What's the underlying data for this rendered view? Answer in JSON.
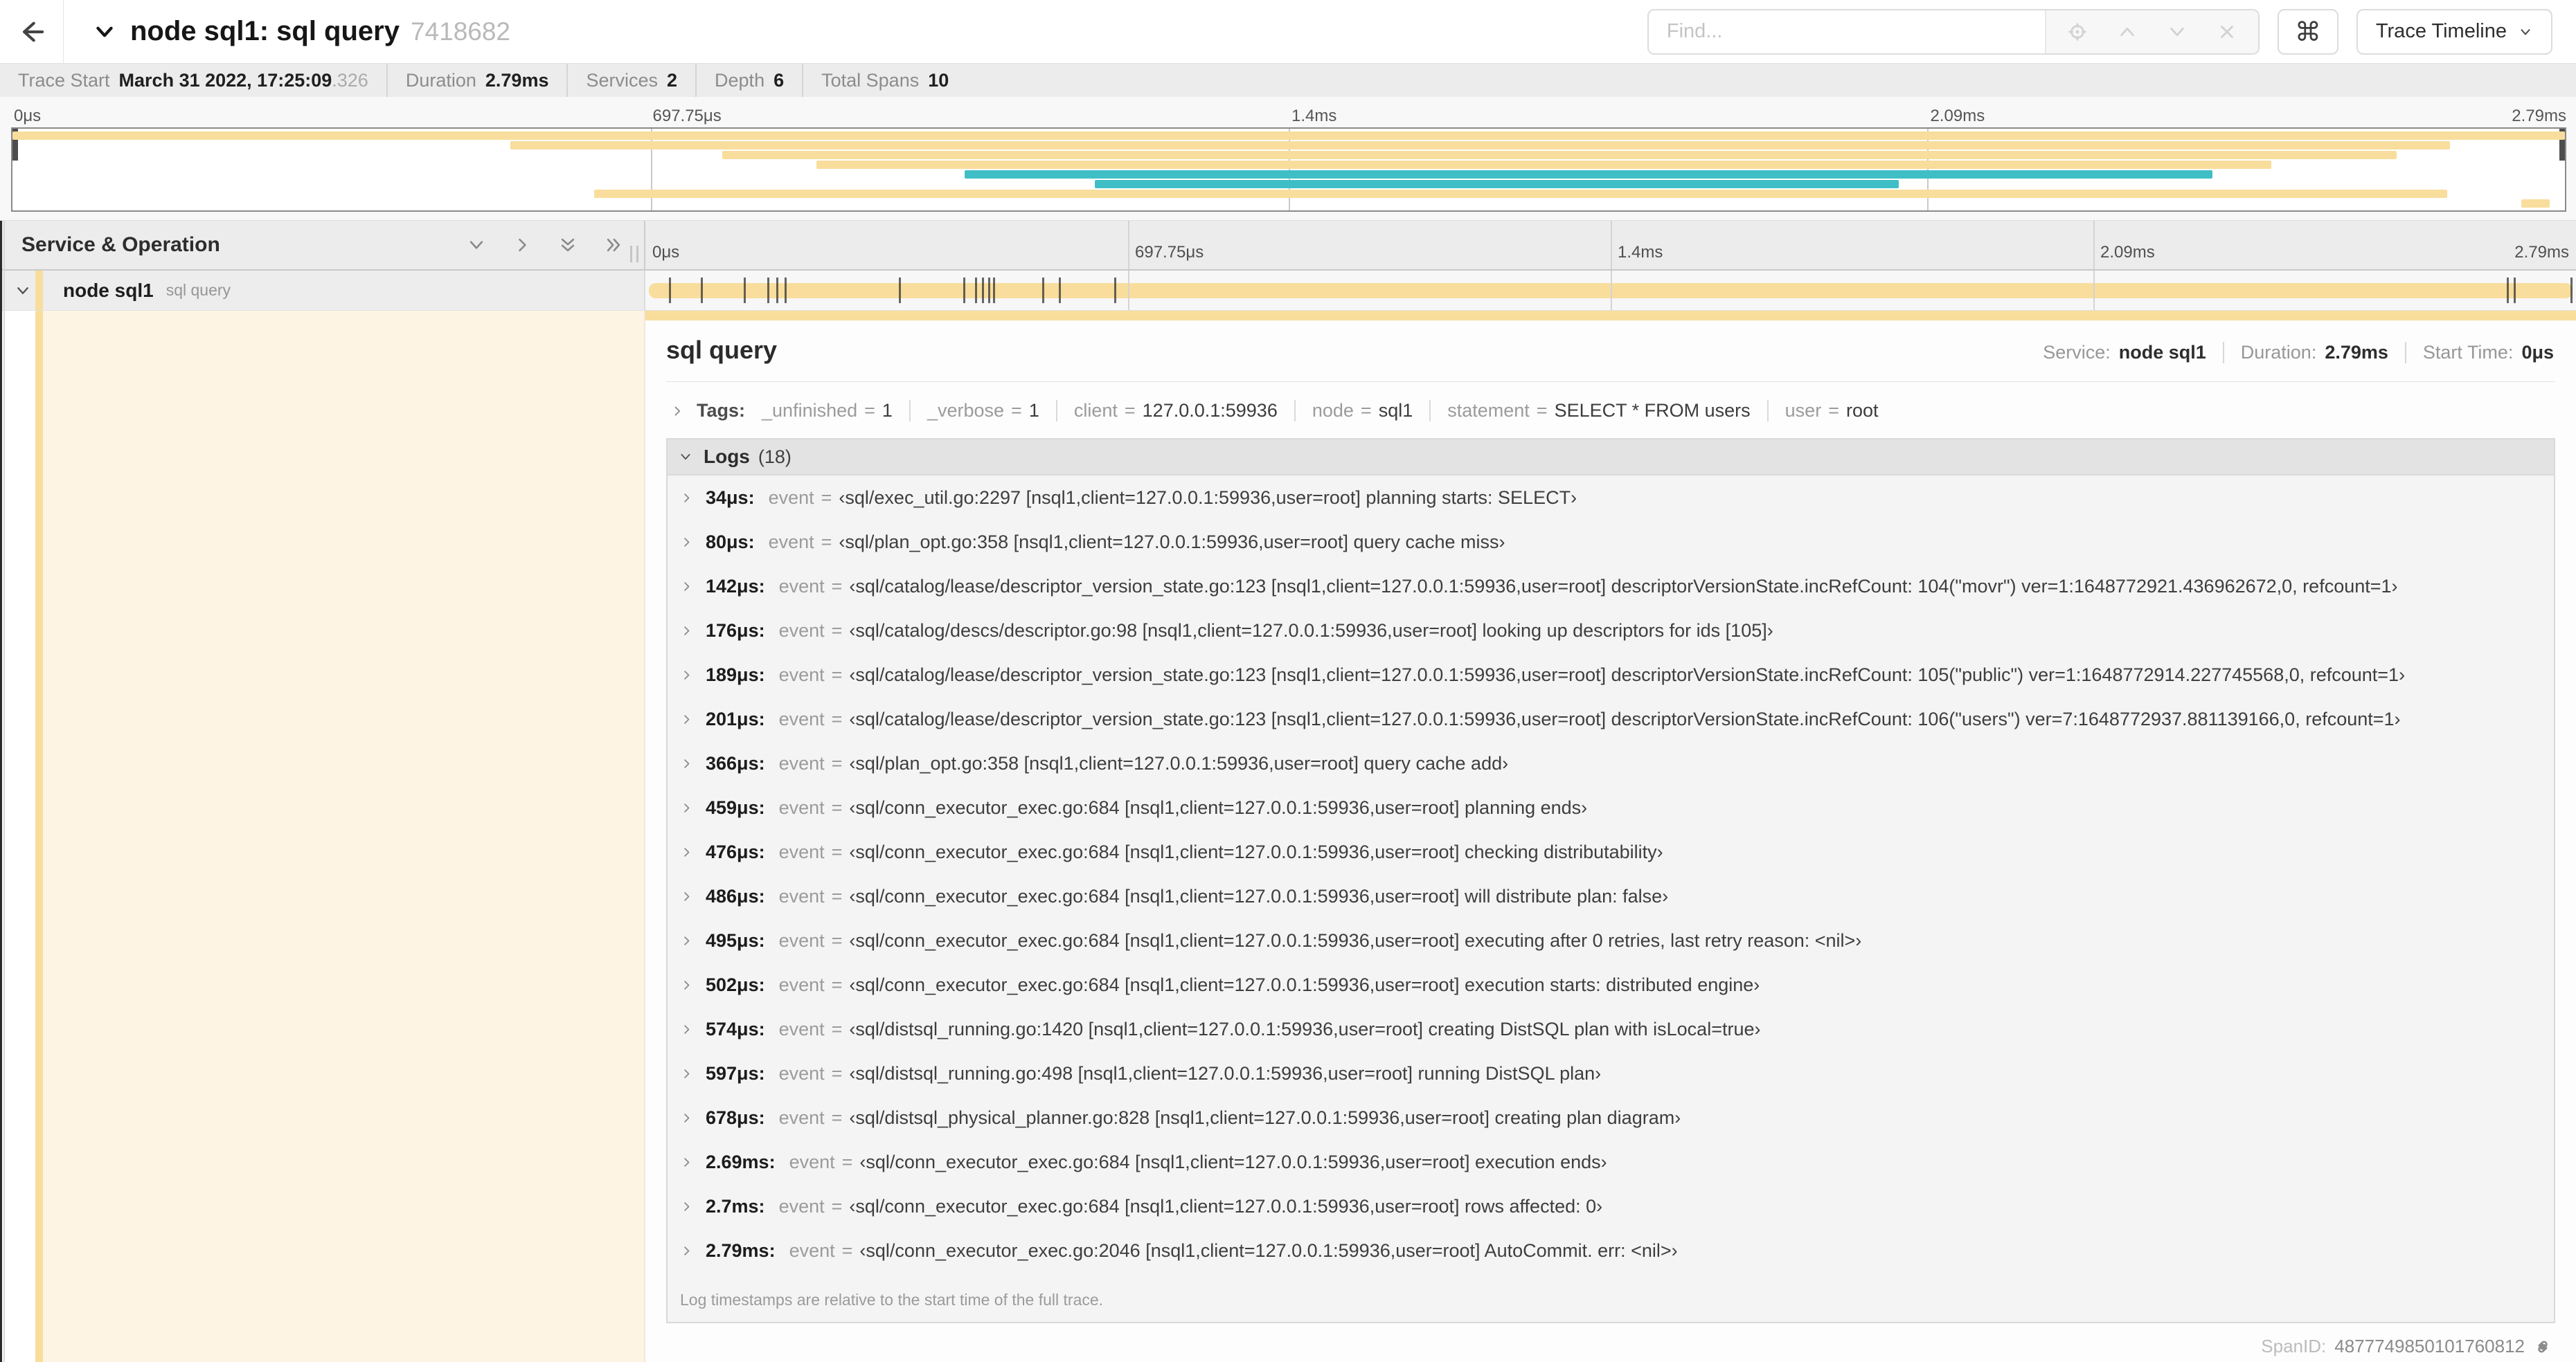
{
  "header": {
    "title": "node sql1: sql query",
    "trace_id": "7418682",
    "find_placeholder": "Find...",
    "shortcut_button": "⌘",
    "view_button": "Trace Timeline"
  },
  "trace_info": {
    "items": [
      {
        "label": "Trace Start",
        "value": "March 31 2022, 17:25:09",
        "suffix": ".326"
      },
      {
        "label": "Duration",
        "value": "2.79ms"
      },
      {
        "label": "Services",
        "value": "2"
      },
      {
        "label": "Depth",
        "value": "6"
      },
      {
        "label": "Total Spans",
        "value": "10"
      }
    ]
  },
  "timeline_ticks": [
    {
      "label": "0μs",
      "pct": 0
    },
    {
      "label": "697.75μs",
      "pct": 25
    },
    {
      "label": "1.4ms",
      "pct": 50
    },
    {
      "label": "2.09ms",
      "pct": 75
    },
    {
      "label": "2.79ms",
      "pct": 100
    }
  ],
  "colors": {
    "tan": "#F8DD9C",
    "teal": "#3FBEC5"
  },
  "minimap": {
    "spans": [
      {
        "color": "tan",
        "start": 0,
        "end": 100
      },
      {
        "color": "tan",
        "start": 19.5,
        "end": 95.5
      },
      {
        "color": "tan",
        "start": 27.8,
        "end": 93.4
      },
      {
        "color": "tan",
        "start": 31.5,
        "end": 88.5
      },
      {
        "color": "teal",
        "start": 37.3,
        "end": 86.2
      },
      {
        "color": "teal",
        "start": 42.4,
        "end": 73.9
      },
      {
        "color": "tan",
        "start": 22.8,
        "end": 95.4
      },
      {
        "color": "tan",
        "start": 98.3,
        "end": 99.4
      }
    ]
  },
  "table": {
    "name_header": "Service & Operation",
    "row": {
      "service": "node sql1",
      "operation": "sql query"
    }
  },
  "detail": {
    "operation": "sql query",
    "overview": [
      {
        "label": "Service:",
        "value": "node sql1"
      },
      {
        "label": "Duration:",
        "value": "2.79ms"
      },
      {
        "label": "Start Time:",
        "value": "0μs"
      }
    ],
    "tags_label": "Tags:",
    "tags": [
      {
        "key": "_unfinished",
        "value": "1"
      },
      {
        "key": "_verbose",
        "value": "1"
      },
      {
        "key": "client",
        "value": "127.0.0.1:59936"
      },
      {
        "key": "node",
        "value": "sql1"
      },
      {
        "key": "statement",
        "value": "SELECT * FROM users"
      },
      {
        "key": "user",
        "value": "root"
      }
    ],
    "logs": {
      "label": "Logs",
      "count": "(18)",
      "entries": [
        {
          "time": "34μs:",
          "pct": 1.22,
          "key": "event",
          "value": "‹sql/exec_util.go:2297 [nsql1,client=127.0.0.1:59936,user=root] planning starts: SELECT›"
        },
        {
          "time": "80μs:",
          "pct": 2.87,
          "key": "event",
          "value": "‹sql/plan_opt.go:358 [nsql1,client=127.0.0.1:59936,user=root] query cache miss›"
        },
        {
          "time": "142μs:",
          "pct": 5.09,
          "key": "event",
          "value": "‹sql/catalog/lease/descriptor_version_state.go:123 [nsql1,client=127.0.0.1:59936,user=root] descriptorVersionState.incRefCount: 104(\"movr\") ver=1:1648772921.436962672,0, refcount=1›"
        },
        {
          "time": "176μs:",
          "pct": 6.31,
          "key": "event",
          "value": "‹sql/catalog/descs/descriptor.go:98 [nsql1,client=127.0.0.1:59936,user=root] looking up descriptors for ids [105]›"
        },
        {
          "time": "189μs:",
          "pct": 6.77,
          "key": "event",
          "value": "‹sql/catalog/lease/descriptor_version_state.go:123 [nsql1,client=127.0.0.1:59936,user=root] descriptorVersionState.incRefCount: 105(\"public\") ver=1:1648772914.227745568,0, refcount=1›"
        },
        {
          "time": "201μs:",
          "pct": 7.2,
          "key": "event",
          "value": "‹sql/catalog/lease/descriptor_version_state.go:123 [nsql1,client=127.0.0.1:59936,user=root] descriptorVersionState.incRefCount: 106(\"users\") ver=7:1648772937.881139166,0, refcount=1›"
        },
        {
          "time": "366μs:",
          "pct": 13.12,
          "key": "event",
          "value": "‹sql/plan_opt.go:358 [nsql1,client=127.0.0.1:59936,user=root] query cache add›"
        },
        {
          "time": "459μs:",
          "pct": 16.45,
          "key": "event",
          "value": "‹sql/conn_executor_exec.go:684 [nsql1,client=127.0.0.1:59936,user=root] planning ends›"
        },
        {
          "time": "476μs:",
          "pct": 17.06,
          "key": "event",
          "value": "‹sql/conn_executor_exec.go:684 [nsql1,client=127.0.0.1:59936,user=root] checking distributability›"
        },
        {
          "time": "486μs:",
          "pct": 17.42,
          "key": "event",
          "value": "‹sql/conn_executor_exec.go:684 [nsql1,client=127.0.0.1:59936,user=root] will distribute plan: false›"
        },
        {
          "time": "495μs:",
          "pct": 17.74,
          "key": "event",
          "value": "‹sql/conn_executor_exec.go:684 [nsql1,client=127.0.0.1:59936,user=root] executing after 0 retries, last retry reason: <nil>›"
        },
        {
          "time": "502μs:",
          "pct": 18.0,
          "key": "event",
          "value": "‹sql/conn_executor_exec.go:684 [nsql1,client=127.0.0.1:59936,user=root] execution starts: distributed engine›"
        },
        {
          "time": "574μs:",
          "pct": 20.57,
          "key": "event",
          "value": "‹sql/distsql_running.go:1420 [nsql1,client=127.0.0.1:59936,user=root] creating DistSQL plan with isLocal=true›"
        },
        {
          "time": "597μs:",
          "pct": 21.4,
          "key": "event",
          "value": "‹sql/distsql_running.go:498 [nsql1,client=127.0.0.1:59936,user=root] running DistSQL plan›"
        },
        {
          "time": "678μs:",
          "pct": 24.3,
          "key": "event",
          "value": "‹sql/distsql_physical_planner.go:828 [nsql1,client=127.0.0.1:59936,user=root] creating plan diagram›"
        },
        {
          "time": "2.69ms:",
          "pct": 96.42,
          "key": "event",
          "value": "‹sql/conn_executor_exec.go:684 [nsql1,client=127.0.0.1:59936,user=root] execution ends›"
        },
        {
          "time": "2.7ms:",
          "pct": 96.77,
          "key": "event",
          "value": "‹sql/conn_executor_exec.go:684 [nsql1,client=127.0.0.1:59936,user=root] rows affected: 0›"
        },
        {
          "time": "2.79ms:",
          "pct": 99.8,
          "key": "event",
          "value": "‹sql/conn_executor_exec.go:2046 [nsql1,client=127.0.0.1:59936,user=root] AutoCommit. err: <nil>›"
        }
      ],
      "note": "Log timestamps are relative to the start time of the full trace."
    },
    "span_id_label": "SpanID:",
    "span_id": "4877749850101760812"
  }
}
